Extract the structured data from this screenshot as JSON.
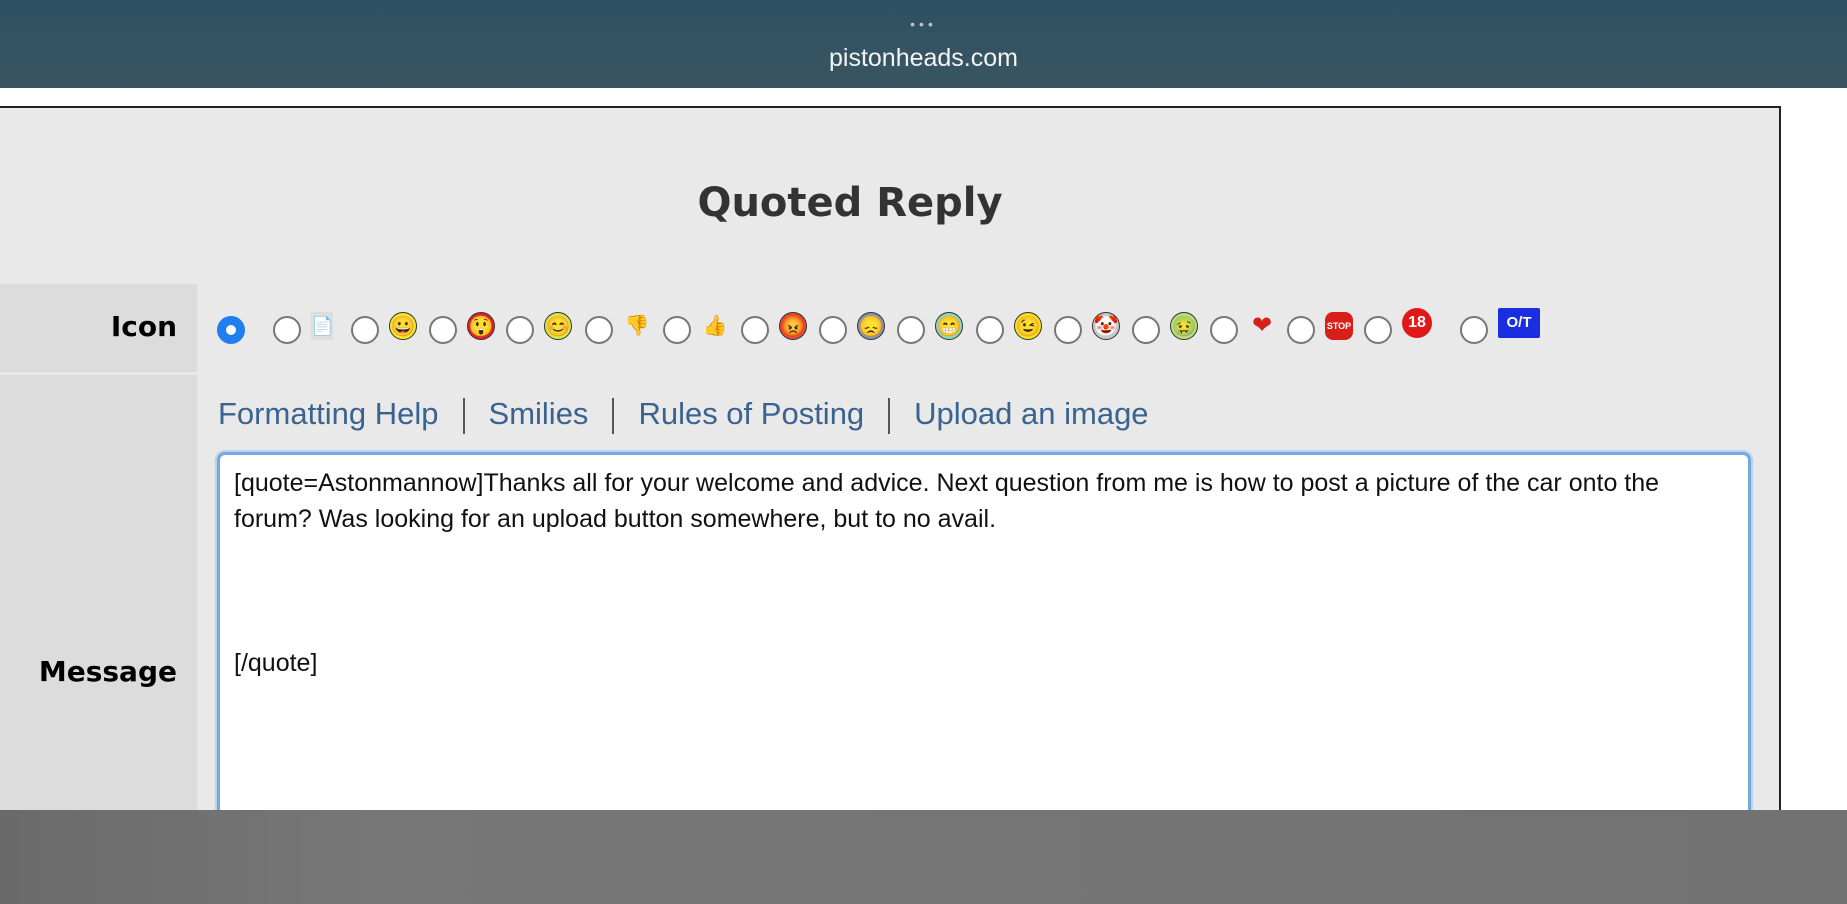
{
  "browser": {
    "dots": "•••",
    "url": "pistonheads.com"
  },
  "form": {
    "title": "Quoted Reply",
    "icon_label": "Icon",
    "message_label": "Message",
    "icons": [
      {
        "name": "none",
        "glyph": "",
        "selected": true
      },
      {
        "name": "note-icon",
        "glyph": "📄"
      },
      {
        "name": "grin-icon",
        "glyph": "😀"
      },
      {
        "name": "shocked-red-icon",
        "glyph": "😲"
      },
      {
        "name": "smile-icon",
        "glyph": "😊"
      },
      {
        "name": "thumbs-down-icon",
        "glyph": "👎"
      },
      {
        "name": "thumbs-up-icon",
        "glyph": "👍"
      },
      {
        "name": "angry-icon",
        "glyph": "😡"
      },
      {
        "name": "sad-icon",
        "glyph": "😞"
      },
      {
        "name": "teeth-grin-icon",
        "glyph": "😁"
      },
      {
        "name": "wink-icon",
        "glyph": "😉"
      },
      {
        "name": "clown-icon",
        "glyph": "🤡"
      },
      {
        "name": "sick-icon",
        "glyph": "🤢"
      },
      {
        "name": "heart-icon",
        "glyph": "❤"
      },
      {
        "name": "stop-sign-icon",
        "glyph": "STOP"
      },
      {
        "name": "eighteen-icon",
        "glyph": "18"
      },
      {
        "name": "off-topic-icon",
        "glyph": "O/T"
      }
    ],
    "links": [
      "Formatting Help",
      "Smilies",
      "Rules of Posting",
      "Upload an image"
    ],
    "message": "[quote=Astonmannow]Thanks all for your welcome and advice. Next question from me is how to post a picture of the car onto the forum? Was looking for an upload button somewhere, but to no avail.\n\n\n\n[/quote]"
  }
}
